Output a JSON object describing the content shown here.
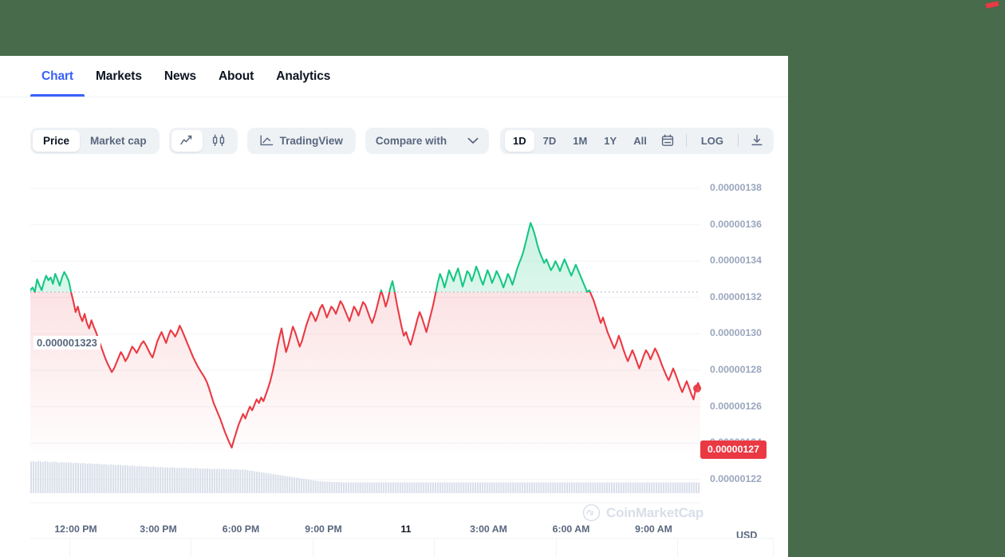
{
  "theme": {
    "outside_bg": "#486b4c",
    "accent_blue": "#3861fb",
    "up_green": "#16c784",
    "down_red": "#ea3943",
    "muted": "#58667e"
  },
  "tabs": [
    {
      "label": "Chart",
      "active": true
    },
    {
      "label": "Markets",
      "active": false
    },
    {
      "label": "News",
      "active": false
    },
    {
      "label": "About",
      "active": false
    },
    {
      "label": "Analytics",
      "active": false
    }
  ],
  "toolbar": {
    "metric_options": [
      {
        "label": "Price",
        "selected": true
      },
      {
        "label": "Market cap",
        "selected": false
      }
    ],
    "charttype_options": [
      {
        "icon": "line-chart-icon",
        "selected": true
      },
      {
        "icon": "candlestick-icon",
        "selected": false
      }
    ],
    "tradingview_label": "TradingView",
    "tradingview_icon": "tradingview-icon",
    "compare_label": "Compare with",
    "compare_icon": "chevron-down-icon",
    "ranges": [
      {
        "label": "1D",
        "selected": true
      },
      {
        "label": "7D",
        "selected": false
      },
      {
        "label": "1M",
        "selected": false
      },
      {
        "label": "1Y",
        "selected": false
      },
      {
        "label": "All",
        "selected": false
      }
    ],
    "calendar_icon": "calendar-icon",
    "log_label": "LOG",
    "download_icon": "download-icon"
  },
  "chart_data": {
    "type": "line",
    "title": "",
    "xlabel": "",
    "ylabel": "",
    "currency": "USD",
    "watermark": "CoinMarketCap",
    "ylim": [
      1.21e-06,
      1.39e-06
    ],
    "ytick_labels": [
      "0.00000138",
      "0.00000136",
      "0.00000134",
      "0.00000132",
      "0.00000130",
      "0.00000128",
      "0.00000126",
      "0.00000124",
      "0.00000122"
    ],
    "ytick_values": [
      1.38e-06,
      1.36e-06,
      1.34e-06,
      1.32e-06,
      1.3e-06,
      1.28e-06,
      1.26e-06,
      1.24e-06,
      1.22e-06
    ],
    "xtick_labels": [
      "12:00 PM",
      "3:00 PM",
      "6:00 PM",
      "9:00 PM",
      "11",
      "3:00 AM",
      "6:00 AM",
      "9:00 AM"
    ],
    "xtick_bold_index": 4,
    "grid": true,
    "legend": "none",
    "reference_line_label": "0.000001323",
    "reference_line_value": 1.323e-06,
    "current_price_label": "0.00000127",
    "current_price_value": 1.27e-06,
    "series": [
      {
        "name": "Price",
        "up_color": "#16c784",
        "down_color": "#ea3943",
        "values": [
          1.324,
          1.3255,
          1.323,
          1.33,
          1.3268,
          1.324,
          1.3285,
          1.332,
          1.3295,
          1.331,
          1.3275,
          1.333,
          1.33,
          1.3265,
          1.331,
          1.334,
          1.3318,
          1.329,
          1.323,
          1.318,
          1.312,
          1.315,
          1.31,
          1.307,
          1.311,
          1.306,
          1.303,
          1.3075,
          1.304,
          1.301,
          1.2975,
          1.294,
          1.2905,
          1.287,
          1.284,
          1.2815,
          1.279,
          1.281,
          1.284,
          1.287,
          1.29,
          1.288,
          1.285,
          1.287,
          1.29,
          1.293,
          1.2915,
          1.2895,
          1.292,
          1.2945,
          1.296,
          1.294,
          1.2915,
          1.289,
          1.287,
          1.291,
          1.2955,
          1.2985,
          1.301,
          1.298,
          1.295,
          1.299,
          1.302,
          1.3005,
          1.2985,
          1.301,
          1.3045,
          1.302,
          1.299,
          1.296,
          1.293,
          1.29,
          1.287,
          1.2845,
          1.282,
          1.28,
          1.278,
          1.276,
          1.2735,
          1.27,
          1.266,
          1.262,
          1.259,
          1.256,
          1.253,
          1.2495,
          1.246,
          1.243,
          1.24,
          1.2375,
          1.242,
          1.246,
          1.25,
          1.253,
          1.256,
          1.2535,
          1.257,
          1.26,
          1.258,
          1.261,
          1.264,
          1.262,
          1.265,
          1.263,
          1.2665,
          1.27,
          1.274,
          1.279,
          1.285,
          1.292,
          1.298,
          1.303,
          1.296,
          1.29,
          1.294,
          1.299,
          1.304,
          1.301,
          1.297,
          1.293,
          1.296,
          1.3005,
          1.305,
          1.3085,
          1.312,
          1.31,
          1.307,
          1.31,
          1.314,
          1.316,
          1.313,
          1.309,
          1.312,
          1.315,
          1.3135,
          1.311,
          1.3145,
          1.318,
          1.316,
          1.313,
          1.31,
          1.307,
          1.311,
          1.315,
          1.313,
          1.31,
          1.314,
          1.3175,
          1.316,
          1.3125,
          1.309,
          1.306,
          1.3095,
          1.314,
          1.319,
          1.324,
          1.32,
          1.315,
          1.319,
          1.325,
          1.329,
          1.323,
          1.316,
          1.31,
          1.304,
          1.299,
          1.301,
          1.297,
          1.294,
          1.2985,
          1.303,
          1.308,
          1.312,
          1.309,
          1.305,
          1.301,
          1.306,
          1.311,
          1.316,
          1.322,
          1.328,
          1.333,
          1.33,
          1.3255,
          1.33,
          1.335,
          1.332,
          1.329,
          1.333,
          1.336,
          1.331,
          1.326,
          1.33,
          1.3345,
          1.333,
          1.329,
          1.3325,
          1.337,
          1.334,
          1.33,
          1.327,
          1.331,
          1.335,
          1.332,
          1.328,
          1.331,
          1.3345,
          1.332,
          1.329,
          1.3255,
          1.329,
          1.333,
          1.3305,
          1.327,
          1.331,
          1.3355,
          1.339,
          1.342,
          1.346,
          1.351,
          1.356,
          1.361,
          1.358,
          1.354,
          1.349,
          1.345,
          1.342,
          1.339,
          1.341,
          1.338,
          1.335,
          1.337,
          1.34,
          1.3375,
          1.3345,
          1.338,
          1.341,
          1.338,
          1.335,
          1.332,
          1.335,
          1.338,
          1.335,
          1.332,
          1.329,
          1.326,
          1.323,
          1.324,
          1.321,
          1.318,
          1.314,
          1.31,
          1.306,
          1.309,
          1.305,
          1.301,
          1.298,
          1.295,
          1.292,
          1.295,
          1.299,
          1.2955,
          1.2915,
          1.288,
          1.285,
          1.288,
          1.291,
          1.288,
          1.2845,
          1.281,
          1.2845,
          1.288,
          1.291,
          1.289,
          1.286,
          1.289,
          1.292,
          1.2895,
          1.2865,
          1.283,
          1.28,
          1.277,
          1.2745,
          1.2775,
          1.281,
          1.278,
          1.2745,
          1.271,
          1.268,
          1.271,
          1.274,
          1.2705,
          1.267,
          1.264,
          1.27,
          1.273,
          1.27
        ],
        "value_scale": "1e-6"
      }
    ],
    "volume": {
      "name": "Volume",
      "color": "#ccd4e3",
      "bars": [
        88,
        89,
        87,
        90,
        88,
        87,
        89,
        88,
        86,
        87,
        88,
        86,
        85,
        87,
        86,
        85,
        86,
        85,
        84,
        85,
        84,
        83,
        84,
        83,
        82,
        83,
        82,
        81,
        82,
        81,
        80,
        81,
        80,
        79,
        80,
        79,
        78,
        79,
        78,
        77,
        78,
        77,
        76,
        77,
        76,
        75,
        76,
        75,
        74,
        75,
        74,
        73,
        74,
        73,
        72,
        73,
        72,
        71,
        72,
        71,
        72,
        71,
        70,
        71,
        70,
        71,
        70,
        69,
        70,
        69,
        70,
        69,
        68,
        69,
        68,
        69,
        68,
        67,
        68,
        67,
        68,
        67,
        68,
        67,
        66,
        67,
        66,
        67,
        66,
        65,
        66,
        65,
        64,
        63,
        62,
        61,
        60,
        59,
        58,
        57,
        56,
        55,
        54,
        53,
        52,
        51,
        50,
        49,
        48,
        47,
        46,
        45,
        44,
        43,
        42,
        41,
        40,
        39,
        38,
        37,
        36,
        35,
        34,
        33,
        33,
        32,
        32,
        32,
        31,
        31,
        31,
        31,
        30,
        30,
        30,
        30,
        30,
        30,
        30,
        30,
        30,
        30,
        30,
        30,
        30,
        30,
        30,
        30,
        30,
        30,
        30,
        30,
        30,
        30,
        30,
        30,
        30,
        30,
        30,
        30,
        30,
        30,
        30,
        30,
        30,
        30,
        30,
        30,
        30,
        30,
        30,
        30,
        30,
        30,
        30,
        30,
        30,
        30,
        30,
        30,
        30,
        30,
        30,
        30,
        30,
        30,
        30,
        30,
        30,
        30,
        30,
        30,
        30,
        30,
        30,
        30,
        30,
        30,
        30,
        30,
        30,
        30,
        30,
        30,
        30,
        30,
        30,
        30,
        30,
        30,
        30,
        30,
        30,
        30,
        30,
        30,
        30,
        30,
        30,
        30,
        30,
        30,
        30,
        30,
        30,
        30,
        30,
        30,
        30,
        30,
        30,
        30,
        30,
        30,
        30,
        30,
        30,
        30,
        30,
        30,
        30,
        30,
        30,
        30,
        30,
        30,
        30,
        30,
        30,
        30,
        30,
        30,
        30,
        30,
        30,
        30,
        30,
        30,
        30,
        30,
        30,
        30,
        30,
        30,
        30,
        30,
        30,
        30,
        30,
        30,
        30,
        30,
        30,
        30,
        30,
        30,
        30,
        30,
        30,
        30,
        30,
        30,
        30,
        30,
        30
      ]
    }
  }
}
